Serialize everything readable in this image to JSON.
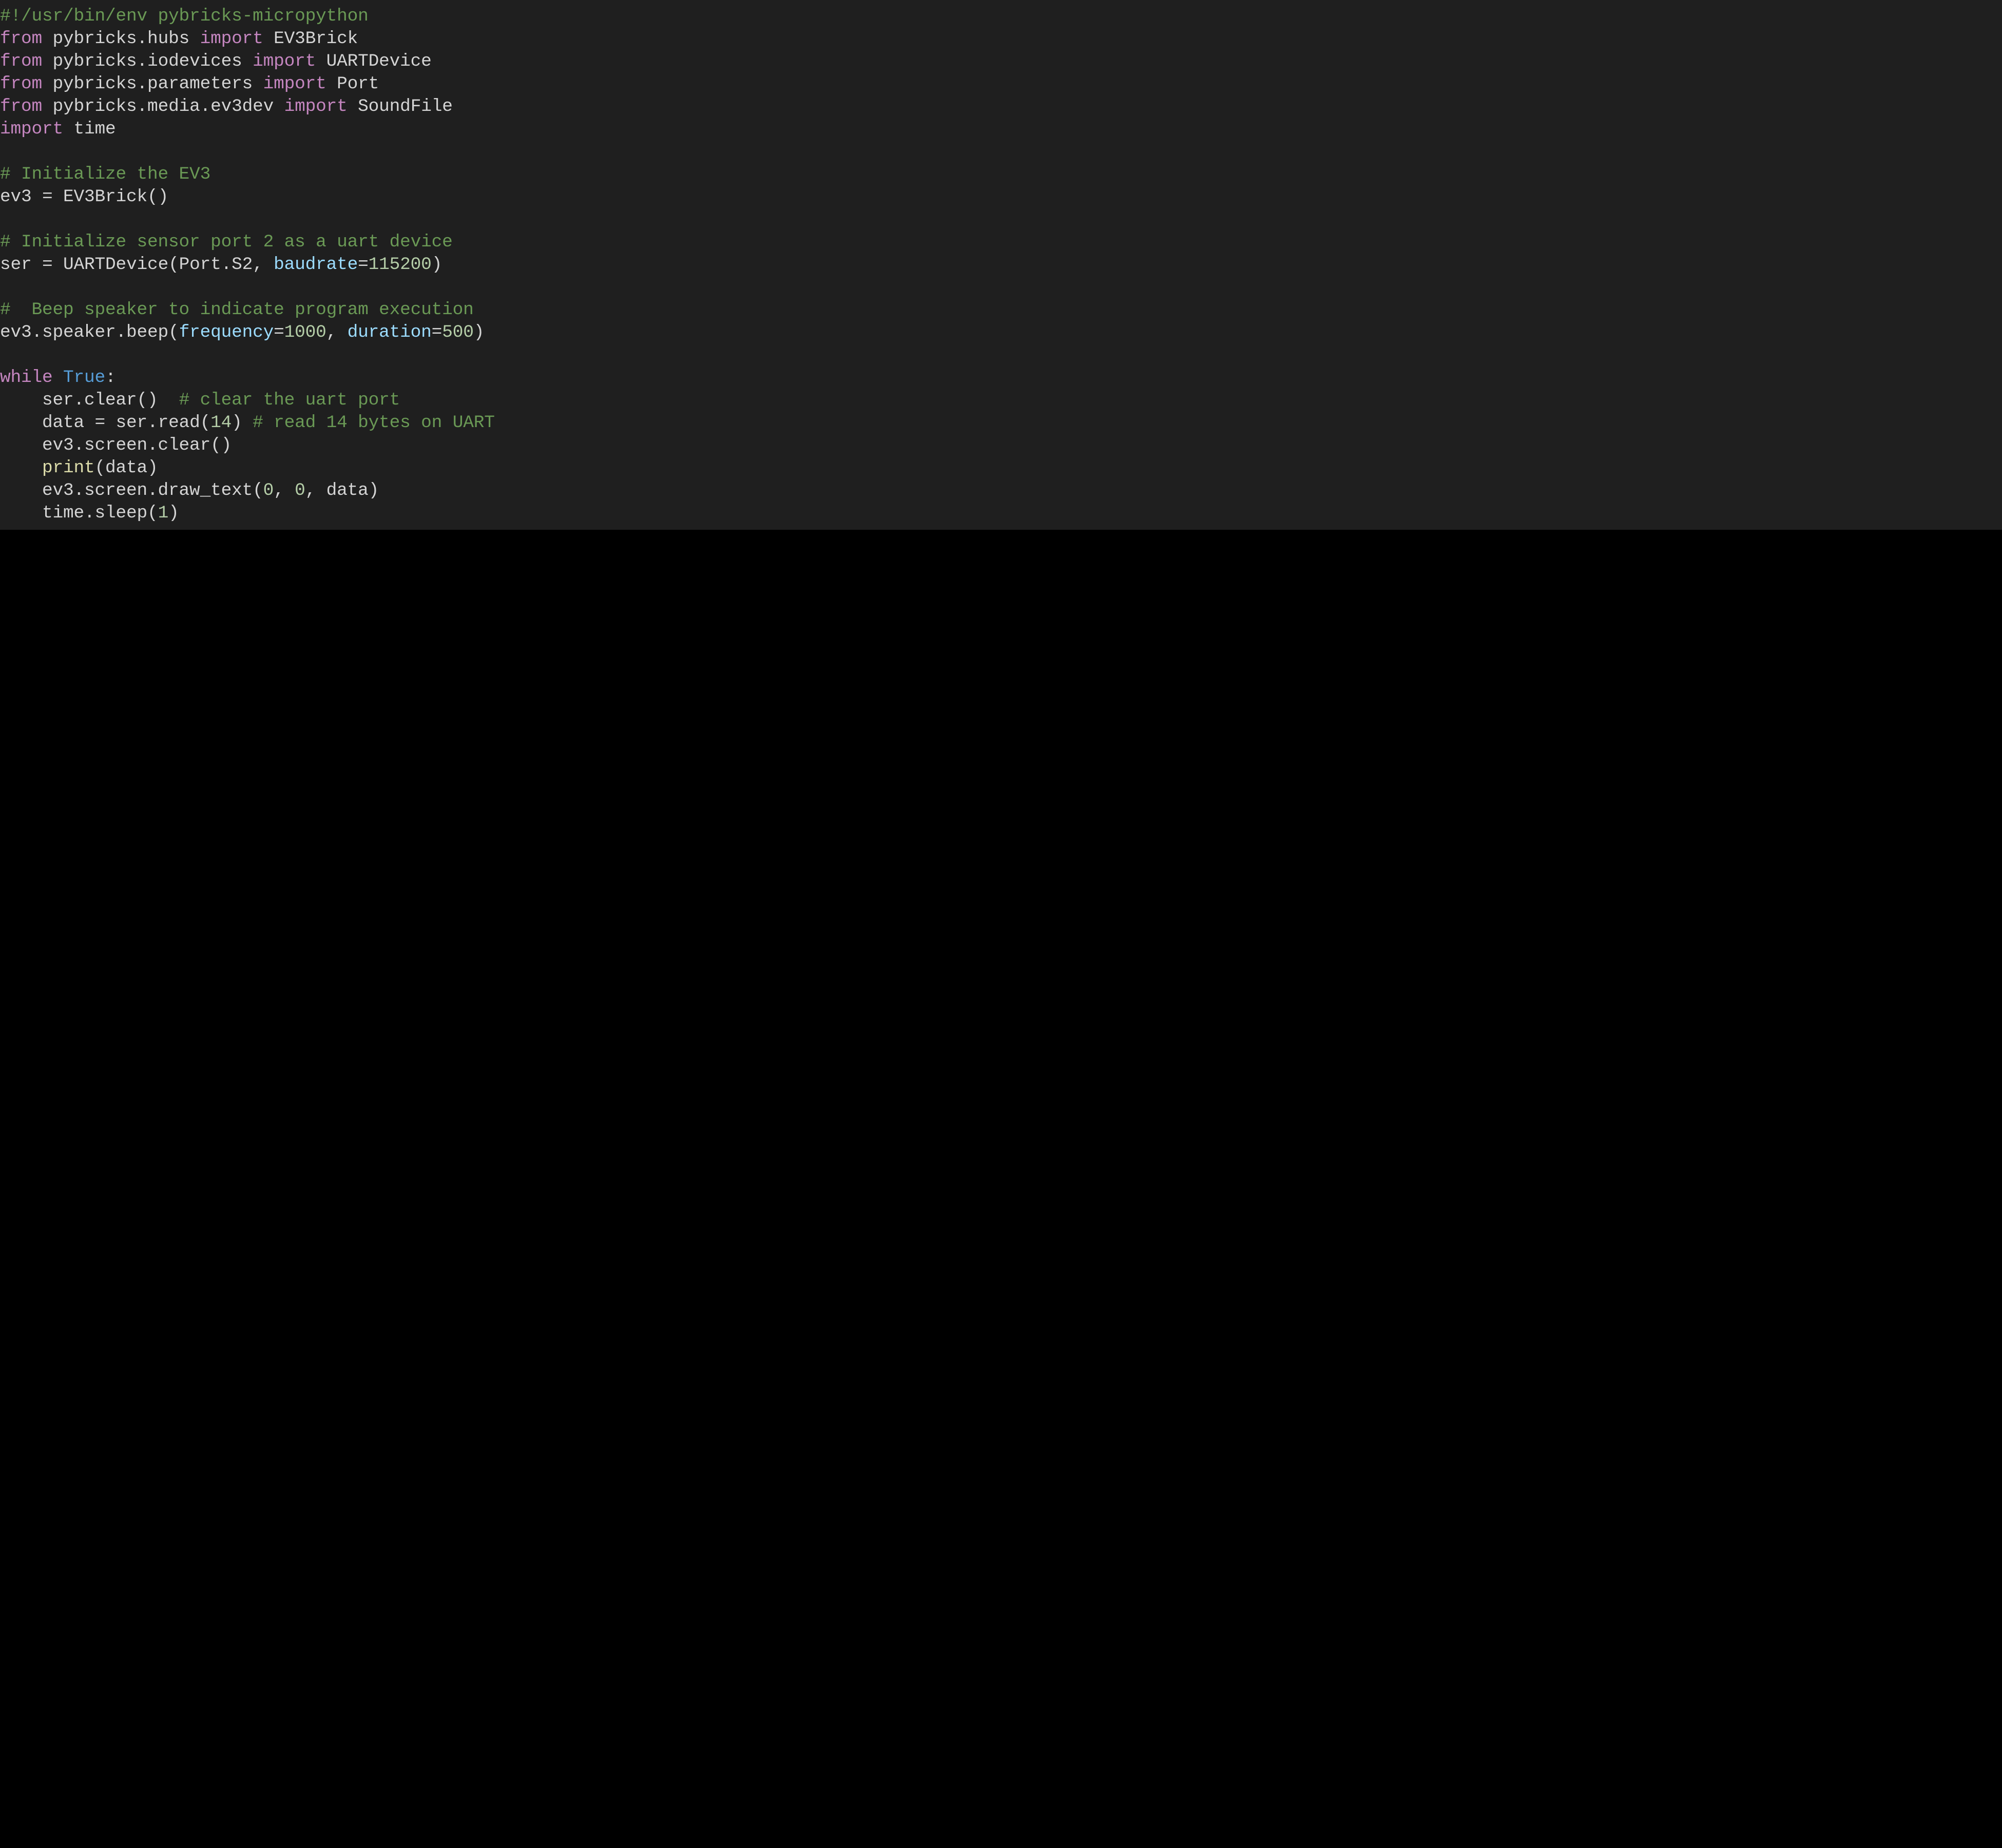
{
  "code": {
    "tokensByLine": [
      [
        {
          "t": "#!/usr/bin/env pybricks-micropython",
          "c": "tok-comment"
        }
      ],
      [
        {
          "t": "from",
          "c": "tok-keyword"
        },
        {
          "t": " ",
          "c": "tok-punct"
        },
        {
          "t": "pybricks.hubs",
          "c": "tok-module"
        },
        {
          "t": " ",
          "c": "tok-punct"
        },
        {
          "t": "import",
          "c": "tok-keyword"
        },
        {
          "t": " ",
          "c": "tok-punct"
        },
        {
          "t": "EV3Brick",
          "c": "tok-class"
        }
      ],
      [
        {
          "t": "from",
          "c": "tok-keyword"
        },
        {
          "t": " ",
          "c": "tok-punct"
        },
        {
          "t": "pybricks.iodevices",
          "c": "tok-module"
        },
        {
          "t": " ",
          "c": "tok-punct"
        },
        {
          "t": "import",
          "c": "tok-keyword"
        },
        {
          "t": " ",
          "c": "tok-punct"
        },
        {
          "t": "UARTDevice",
          "c": "tok-class"
        }
      ],
      [
        {
          "t": "from",
          "c": "tok-keyword"
        },
        {
          "t": " ",
          "c": "tok-punct"
        },
        {
          "t": "pybricks.parameters",
          "c": "tok-module"
        },
        {
          "t": " ",
          "c": "tok-punct"
        },
        {
          "t": "import",
          "c": "tok-keyword"
        },
        {
          "t": " ",
          "c": "tok-punct"
        },
        {
          "t": "Port",
          "c": "tok-class"
        }
      ],
      [
        {
          "t": "from",
          "c": "tok-keyword"
        },
        {
          "t": " ",
          "c": "tok-punct"
        },
        {
          "t": "pybricks.media.ev3dev",
          "c": "tok-module"
        },
        {
          "t": " ",
          "c": "tok-punct"
        },
        {
          "t": "import",
          "c": "tok-keyword"
        },
        {
          "t": " ",
          "c": "tok-punct"
        },
        {
          "t": "SoundFile",
          "c": "tok-class"
        }
      ],
      [
        {
          "t": "import",
          "c": "tok-keyword"
        },
        {
          "t": " ",
          "c": "tok-punct"
        },
        {
          "t": "time",
          "c": "tok-module"
        }
      ],
      [],
      [
        {
          "t": "# Initialize the EV3",
          "c": "tok-comment"
        }
      ],
      [
        {
          "t": "ev3 ",
          "c": "tok-ident"
        },
        {
          "t": "=",
          "c": "tok-punct"
        },
        {
          "t": " EV3Brick()",
          "c": "tok-ident"
        }
      ],
      [],
      [
        {
          "t": "# Initialize sensor port 2 as a uart device",
          "c": "tok-comment"
        }
      ],
      [
        {
          "t": "ser ",
          "c": "tok-ident"
        },
        {
          "t": "=",
          "c": "tok-punct"
        },
        {
          "t": " UARTDevice(Port.S2, ",
          "c": "tok-ident"
        },
        {
          "t": "baudrate",
          "c": "tok-param"
        },
        {
          "t": "=",
          "c": "tok-punct"
        },
        {
          "t": "115200",
          "c": "tok-number"
        },
        {
          "t": ")",
          "c": "tok-punct"
        }
      ],
      [],
      [
        {
          "t": "#  Beep speaker to indicate program execution",
          "c": "tok-comment"
        }
      ],
      [
        {
          "t": "ev3.speaker.beep(",
          "c": "tok-ident"
        },
        {
          "t": "frequency",
          "c": "tok-param"
        },
        {
          "t": "=",
          "c": "tok-punct"
        },
        {
          "t": "1000",
          "c": "tok-number"
        },
        {
          "t": ", ",
          "c": "tok-punct"
        },
        {
          "t": "duration",
          "c": "tok-param"
        },
        {
          "t": "=",
          "c": "tok-punct"
        },
        {
          "t": "500",
          "c": "tok-number"
        },
        {
          "t": ")",
          "c": "tok-punct"
        }
      ],
      [],
      [
        {
          "t": "while",
          "c": "tok-keyword"
        },
        {
          "t": " ",
          "c": "tok-punct"
        },
        {
          "t": "True",
          "c": "tok-const"
        },
        {
          "t": ":",
          "c": "tok-punct"
        }
      ],
      [
        {
          "t": "    ser.clear()  ",
          "c": "tok-ident"
        },
        {
          "t": "# clear the uart port",
          "c": "tok-comment"
        }
      ],
      [
        {
          "t": "    data ",
          "c": "tok-ident"
        },
        {
          "t": "=",
          "c": "tok-punct"
        },
        {
          "t": " ser.read(",
          "c": "tok-ident"
        },
        {
          "t": "14",
          "c": "tok-number"
        },
        {
          "t": ") ",
          "c": "tok-punct"
        },
        {
          "t": "# read 14 bytes on UART",
          "c": "tok-comment"
        }
      ],
      [
        {
          "t": "    ev3.screen.clear()",
          "c": "tok-ident"
        }
      ],
      [
        {
          "t": "    ",
          "c": "tok-punct"
        },
        {
          "t": "print",
          "c": "tok-func"
        },
        {
          "t": "(data)",
          "c": "tok-ident"
        }
      ],
      [
        {
          "t": "    ev3.screen.draw_text(",
          "c": "tok-ident"
        },
        {
          "t": "0",
          "c": "tok-number"
        },
        {
          "t": ", ",
          "c": "tok-punct"
        },
        {
          "t": "0",
          "c": "tok-number"
        },
        {
          "t": ", data)",
          "c": "tok-ident"
        }
      ],
      [
        {
          "t": "    time.sleep(",
          "c": "tok-ident"
        },
        {
          "t": "1",
          "c": "tok-number"
        },
        {
          "t": ")",
          "c": "tok-punct"
        }
      ]
    ]
  }
}
